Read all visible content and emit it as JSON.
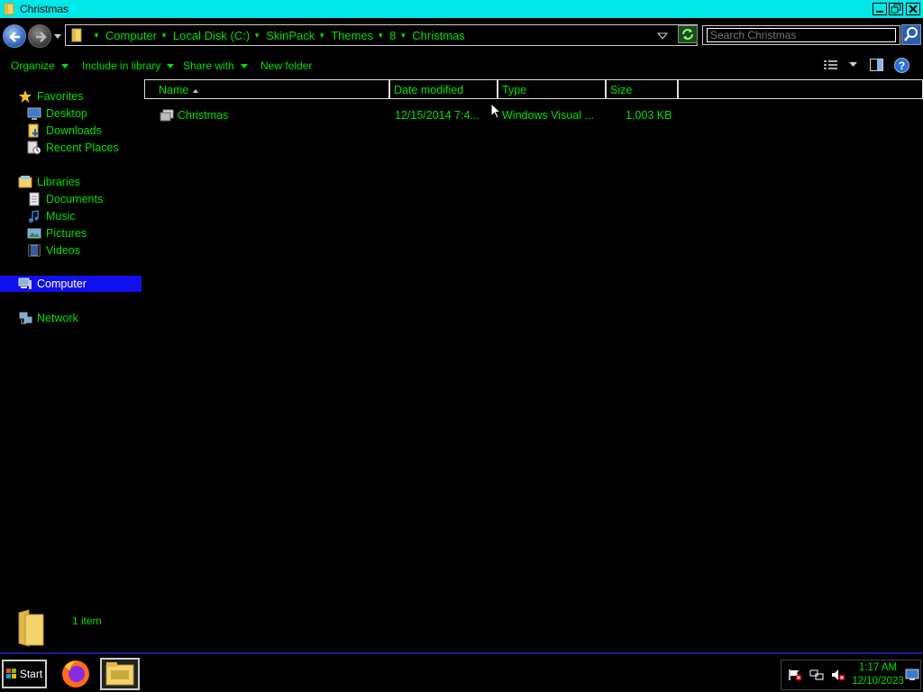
{
  "window": {
    "title": "Christmas"
  },
  "address": {
    "crumbs": [
      "Computer",
      "Local Disk (C:)",
      "SkinPack",
      "Themes",
      "8",
      "Christmas"
    ]
  },
  "search": {
    "placeholder": "Search Christmas"
  },
  "toolbar": {
    "organize": "Organize",
    "include_in_library": "Include in library",
    "share_with": "Share with",
    "new_folder": "New folder"
  },
  "nav": {
    "favorites": "Favorites",
    "desktop": "Desktop",
    "downloads": "Downloads",
    "recent_places": "Recent Places",
    "libraries": "Libraries",
    "documents": "Documents",
    "music": "Music",
    "pictures": "Pictures",
    "videos": "Videos",
    "computer": "Computer",
    "network": "Network"
  },
  "columns": {
    "name": "Name",
    "date_modified": "Date modified",
    "type": "Type",
    "size": "Size"
  },
  "files": [
    {
      "name": "Christmas",
      "date_modified": "12/15/2014 7:4...",
      "type": "Windows Visual ...",
      "size": "1,003 KB"
    }
  ],
  "details": {
    "item_count": "1 item"
  },
  "taskbar": {
    "start": "Start",
    "time": "1:17 AM",
    "date": "12/10/2023"
  },
  "colors": {
    "text": "#00e000",
    "title_bar": "#00e8e8",
    "selection": "#1010ee"
  }
}
